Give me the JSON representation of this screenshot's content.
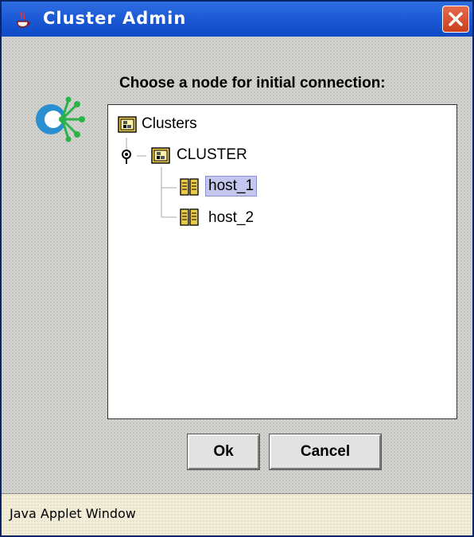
{
  "window": {
    "title": "Cluster Admin",
    "close_icon": "close-icon"
  },
  "dialog": {
    "prompt": "Choose a node for initial connection:",
    "logo_icon": "cluster-logo-icon"
  },
  "tree": {
    "root": {
      "label": "Clusters",
      "icon": "cluster-folder-icon"
    },
    "cluster": {
      "label": "CLUSTER",
      "icon": "cluster-folder-icon",
      "expanded": true
    },
    "hosts": [
      {
        "label": "host_1",
        "icon": "server-icon",
        "selected": true
      },
      {
        "label": "host_2",
        "icon": "server-icon",
        "selected": false
      }
    ]
  },
  "buttons": {
    "ok_label": "Ok",
    "cancel_label": "Cancel"
  },
  "status_bar": {
    "text": "Java Applet Window"
  },
  "colors": {
    "title_bar": "#1d5ad6",
    "close_button": "#d9542c",
    "selection": "#c5c6ee",
    "status_bar": "#f3eed7"
  }
}
